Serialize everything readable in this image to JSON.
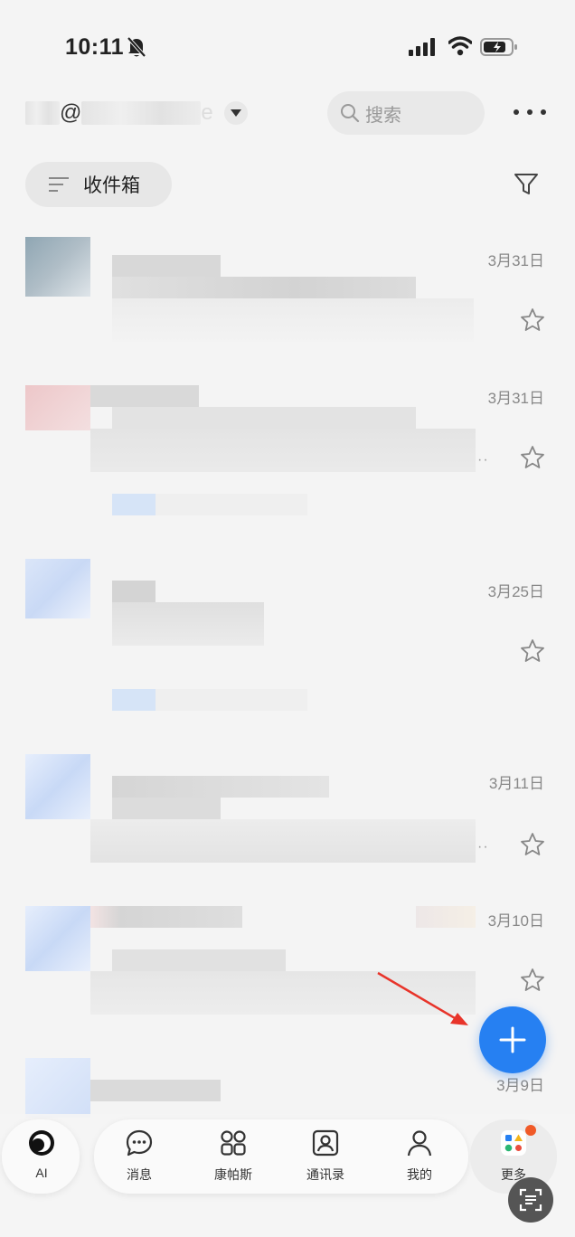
{
  "status_bar": {
    "time": "10:11"
  },
  "header": {
    "account_prefix": "(",
    "account_at": "@",
    "account_suffix": "e",
    "search_placeholder": "搜索"
  },
  "folder": {
    "label": "收件箱"
  },
  "mails": [
    {
      "date": "3月31日",
      "has_ellipsis": false
    },
    {
      "date": "3月31日",
      "has_ellipsis": true
    },
    {
      "date": "3月25日",
      "has_ellipsis": false
    },
    {
      "date": "3月11日",
      "has_ellipsis": true
    },
    {
      "date": "3月10日",
      "has_ellipsis": false
    },
    {
      "date": "3月9日",
      "has_ellipsis": false
    }
  ],
  "ellipsis": "··",
  "tabs": {
    "ai": "AI",
    "messages": "消息",
    "compass": "康帕斯",
    "contacts": "通讯录",
    "mine": "我的",
    "more": "更多"
  },
  "colors": {
    "accent": "#2680f2",
    "badge": "#f05a28",
    "arrow": "#e8342a"
  }
}
